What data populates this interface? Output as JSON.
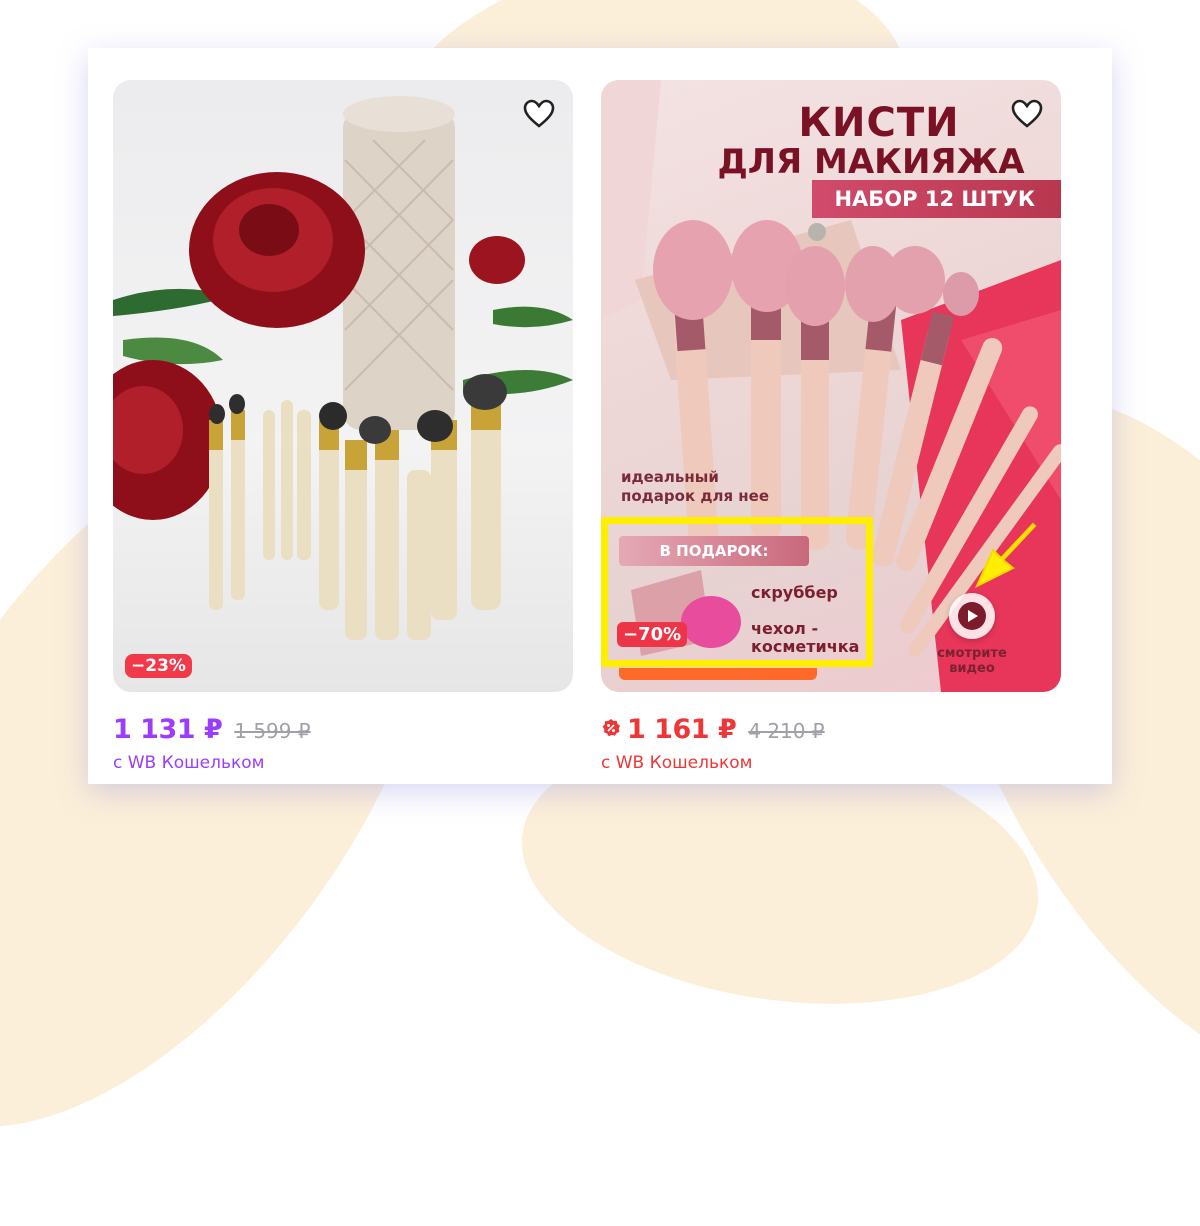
{
  "cards": [
    {
      "discount": "−23%",
      "price": "1 131 ₽",
      "old_price": "1 599 ₽",
      "wallet_text": "с WB Кошельком",
      "price_color": "#9b3cff"
    },
    {
      "banner": {
        "title_line1": "КИСТИ",
        "title_line2": "ДЛЯ МАКИЯЖА",
        "set_badge": "НАБОР 12 ШТУК",
        "gift_idea_line1": "идеальный",
        "gift_idea_line2": "подарок для нее",
        "gift_label": "В ПОДАРОК:",
        "gift_item_1": "скруббер",
        "gift_item_2_line1": "чехол -",
        "gift_item_2_line2": "косметичка",
        "promo_badge": "−70%",
        "video_line1": "смотрите",
        "video_line2": "видео"
      },
      "price": "1 161 ₽",
      "old_price": "4 210 ₽",
      "wallet_text": "с WB Кошельком",
      "price_color": "#ee3636"
    }
  ],
  "icons": {
    "favorite": "heart-outline-icon",
    "play": "play-icon",
    "promo": "percent-badge-icon",
    "pointer_arrow": "arrow-icon"
  },
  "colors": {
    "highlight": "#ffee00",
    "discount_badge": "#f2394a",
    "wallet_purple": "#9b3cff",
    "wallet_red": "#ee3636"
  }
}
